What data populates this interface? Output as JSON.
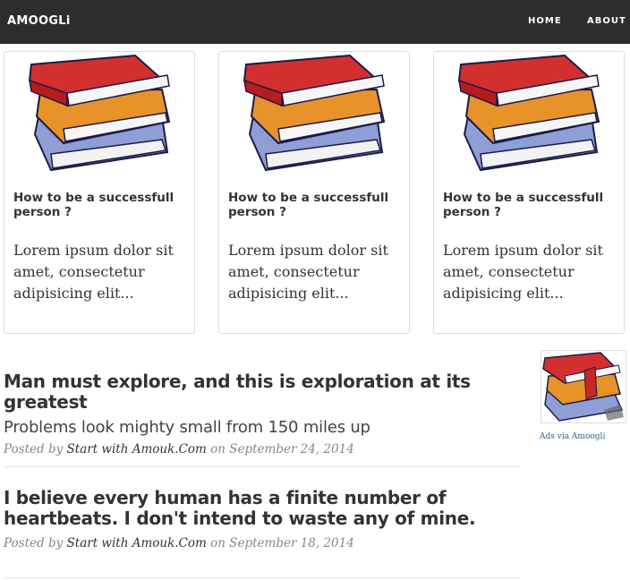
{
  "nav": {
    "brand": "AMOOGLi",
    "links": [
      "HOME",
      "ABOUT"
    ]
  },
  "cards": [
    {
      "title": "How to be a successfull person ?",
      "text": "Lorem ipsum dolor sit amet, consectetur adipisicing elit..."
    },
    {
      "title": "How to be a successfull person ?",
      "text": "Lorem ipsum dolor sit amet, consectetur adipisicing elit..."
    },
    {
      "title": "How to be a successfull person ?",
      "text": "Lorem ipsum dolor sit amet, consectetur adipisicing elit..."
    }
  ],
  "posts": [
    {
      "title": "Man must explore, and this is exploration at its greatest",
      "subtitle": "Problems look mighty small from 150 miles up",
      "posted_by": "Posted by",
      "author": "Start with Amouk.Com",
      "on": "on",
      "date": "September 24, 2014"
    },
    {
      "title": "I believe every human has a finite number of heartbeats. I don't intend to waste any of mine.",
      "posted_by": "Posted by",
      "author": "Start with Amouk.Com",
      "on": "on",
      "date": "September 18, 2014"
    }
  ],
  "ad": {
    "caption": "Ads via Amoogli"
  },
  "colors": {
    "navbar": "#2d2d2d",
    "book_red": "#d32f2f",
    "book_orange": "#e8922a",
    "book_blue": "#8f9fd6",
    "link_blue": "#2a6496"
  }
}
